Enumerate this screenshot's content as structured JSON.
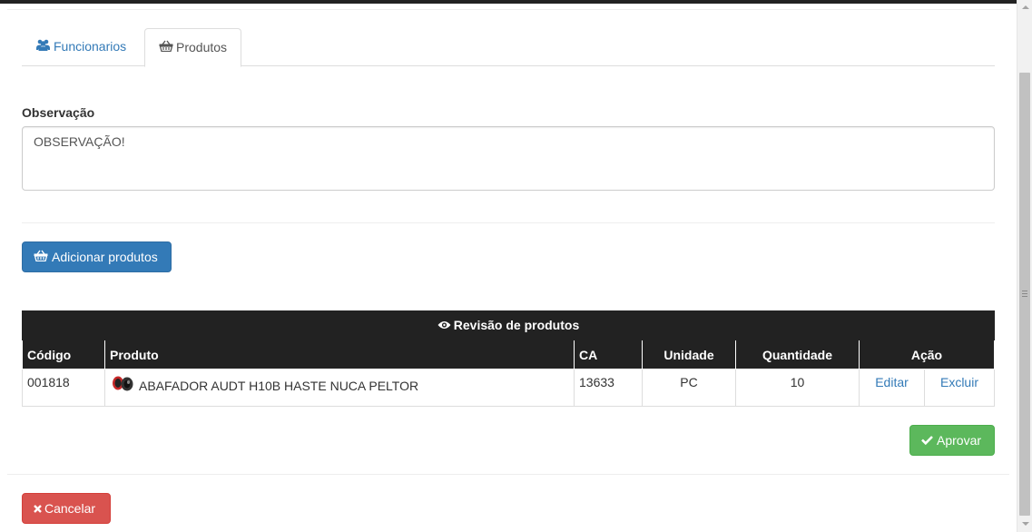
{
  "tabs": [
    {
      "label": "Funcionarios",
      "icon": "users-icon",
      "active": false
    },
    {
      "label": "Produtos",
      "icon": "basket-icon",
      "active": true
    }
  ],
  "observation": {
    "label": "Observação",
    "value": "OBSERVAÇÃO!"
  },
  "add_button": {
    "label": "Adicionar produtos",
    "icon": "basket-icon"
  },
  "table": {
    "caption": "Revisão de produtos",
    "caption_icon": "eye-icon",
    "columns": [
      "Código",
      "Produto",
      "CA",
      "Unidade",
      "Quantidade",
      "Ação"
    ],
    "rows": [
      {
        "code": "001818",
        "product": "ABAFADOR AUDT H10B HASTE NUCA PELTOR",
        "ca": "13633",
        "unit": "PC",
        "quantity": "10",
        "edit": "Editar",
        "delete": "Excluir"
      }
    ]
  },
  "approve_button": {
    "label": "Aprovar",
    "icon": "check-icon"
  },
  "cancel_button": {
    "label": "Cancelar",
    "icon": "times-icon"
  },
  "colors": {
    "primary": "#337ab7",
    "success": "#5cb85c",
    "danger": "#d9534f",
    "table_header": "#222222"
  }
}
